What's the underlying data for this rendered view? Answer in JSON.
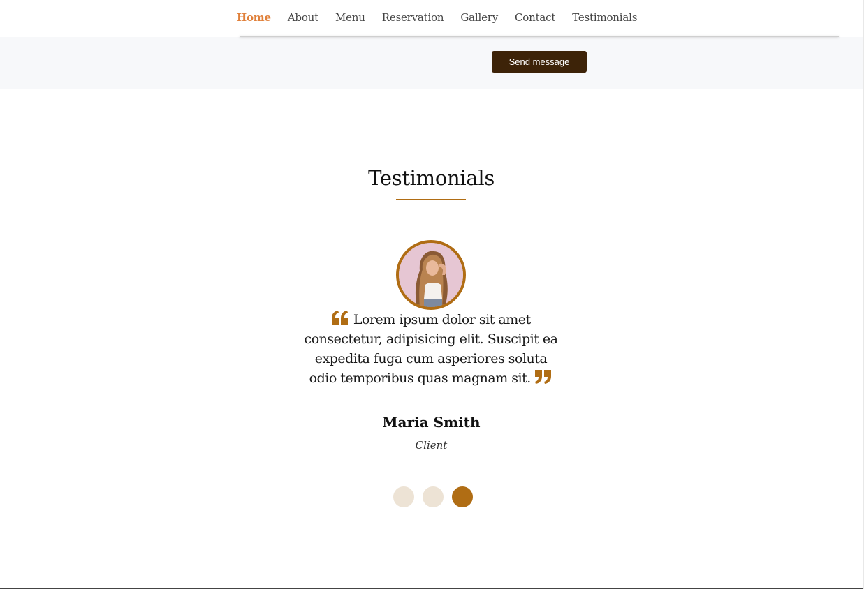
{
  "nav": {
    "items": [
      {
        "label": "Home",
        "active": true
      },
      {
        "label": "About",
        "active": false
      },
      {
        "label": "Menu",
        "active": false
      },
      {
        "label": "Reservation",
        "active": false
      },
      {
        "label": "Gallery",
        "active": false
      },
      {
        "label": "Contact",
        "active": false
      },
      {
        "label": "Testimonials",
        "active": false
      }
    ]
  },
  "contact": {
    "send_label": "Send message"
  },
  "testimonials": {
    "title": "Testimonials",
    "quote": "Lorem ipsum dolor sit amet consectetur, adipisicing elit. Suscipit ea expedita fuga cum asperiores soluta odio temporibus quas magnam sit.",
    "name": "Maria Smith",
    "role": "Client",
    "slides": 3,
    "active_slide": 3
  },
  "colors": {
    "accent": "#b06d14",
    "nav_active": "#e0803a",
    "button": "#3d2308",
    "dot_inactive": "#ede3d5",
    "strip_bg": "#f7f8fa"
  },
  "icons": {
    "open_quote": "quote-left-icon",
    "close_quote": "quote-right-icon"
  }
}
